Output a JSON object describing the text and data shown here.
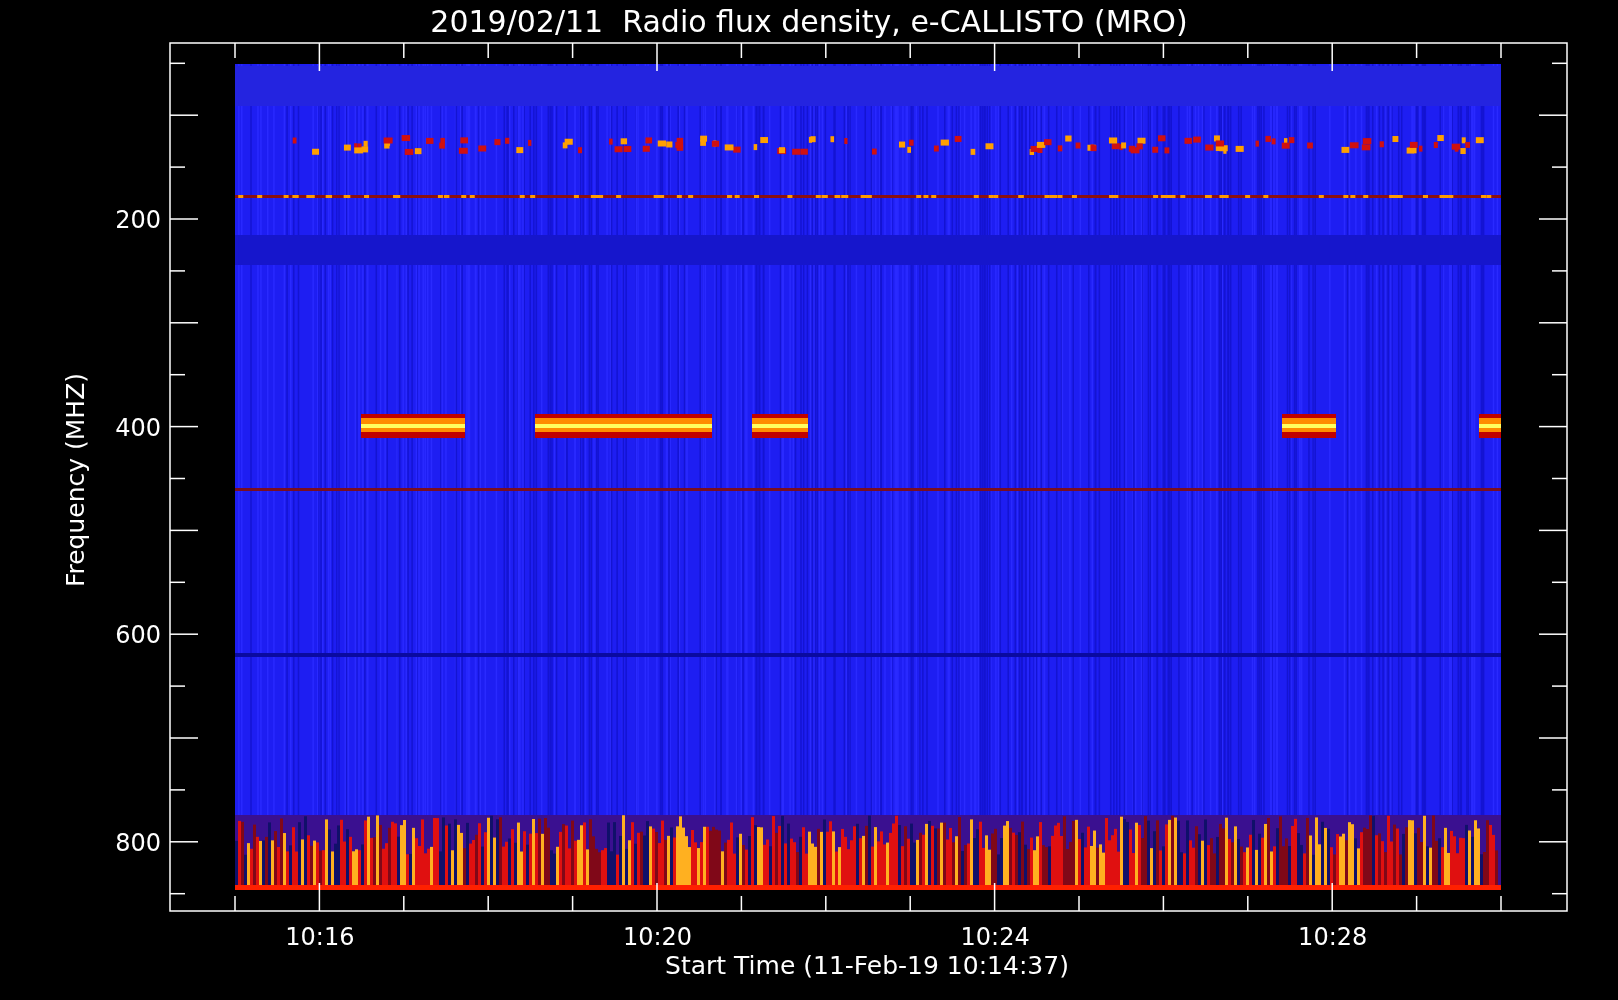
{
  "title": "2019/02/11  Radio flux density, e-CALLISTO (MRO)",
  "y_axis": {
    "label": "Frequency (MHZ)",
    "tick_labels": [
      "200",
      "400",
      "600",
      "800"
    ]
  },
  "x_axis": {
    "label": "Start Time (11-Feb-19 10:14:37)",
    "tick_labels": [
      "10:16",
      "10:20",
      "10:24",
      "10:28"
    ]
  }
}
